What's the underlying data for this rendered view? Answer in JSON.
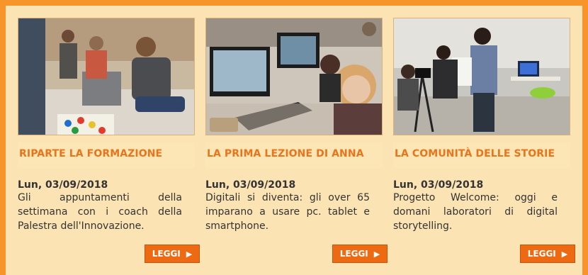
{
  "articles": [
    {
      "title": "RIPARTE LA FORMAZIONE",
      "date": "Lun, 03/09/2018",
      "summary": "Gli appuntamenti della settimana con i coach della Palestra dell'Innovazione.",
      "button": "LEGGI",
      "photo": "group-training-photo"
    },
    {
      "title": "LA PRIMA LEZIONE DI ANNA",
      "date": "Lun, 03/09/2018",
      "summary": "Digitali si diventa: gli over 65 imparano a usare pc. tablet e smartphone.",
      "button": "LEGGI",
      "photo": "computer-lesson-photo"
    },
    {
      "title": "LA COMUNITÀ DELLE STORIE",
      "date": "Lun, 03/09/2018",
      "summary": "Progetto Welcome: oggi e domani laboratori di digital storytelling.",
      "button": "LEGGI",
      "photo": "storytelling-lab-photo"
    }
  ],
  "colors": {
    "frame": "#f7942a",
    "panel": "#fbe3b3",
    "title": "#e8741c",
    "button": "#ee6a12"
  },
  "icons": {
    "button_arrow": "play-arrow-icon"
  }
}
